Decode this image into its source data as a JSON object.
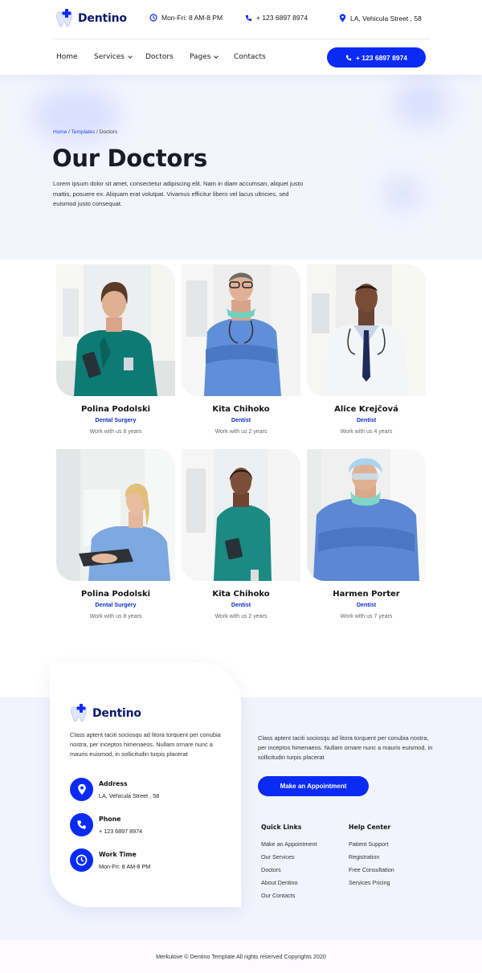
{
  "brand": {
    "name": "Dentino"
  },
  "topbar": {
    "hours": "Mon-Fri: 8 AM-8 PM",
    "phone": "+ 123 6897 8974",
    "address": "LA, Vehicula Street , 58"
  },
  "nav": {
    "items": [
      {
        "label": "Home",
        "dropdown": false
      },
      {
        "label": "Services",
        "dropdown": true
      },
      {
        "label": "Doctors",
        "dropdown": false
      },
      {
        "label": "Pages",
        "dropdown": true
      },
      {
        "label": "Contacts",
        "dropdown": false
      }
    ],
    "cta_label": "+ 123 6897 8974"
  },
  "hero": {
    "breadcrumb": {
      "home": "Home",
      "templates": "Templates",
      "current": "Doctors",
      "separator": "/"
    },
    "title": "Our Doctors",
    "text": "Lorem ipsum dolor sit amet, consectetur adipiscing elit. Nam in diam accumsan, aliquet justo mattis, posuere ex. Aliquam erat volutpat. Vivamus efficitur libero vel lacus ultricies, sed euismod justo consequat."
  },
  "doctors": [
    {
      "name": "Polina Podolski",
      "role": "Dental Surgery",
      "experience": "Work with us 8 years"
    },
    {
      "name": "Kita Chihoko",
      "role": "Dentist",
      "experience": "Work with us 2 years"
    },
    {
      "name": "Alice Krejčová",
      "role": "Dentist",
      "experience": "Work with us 4 years"
    },
    {
      "name": "Polina Podolski",
      "role": "Dental Surgery",
      "experience": "Work with us 8 years"
    },
    {
      "name": "Kita Chihoko",
      "role": "Dentist",
      "experience": "Work with us 2 years"
    },
    {
      "name": "Harmen Porter",
      "role": "Dentist",
      "experience": "Work with us 7 years"
    }
  ],
  "footer": {
    "brand": "Dentino",
    "about": "Class aptent taciti sociosqu ad litora torquent per conubia nostra, per inceptos himenaeos. Nullam ornare nunc a mauris euismod, in sollicitudin turpis placerat",
    "contacts": [
      {
        "title": "Address",
        "value": "LA, Vehicula Street , 58",
        "icon": "location-pin-icon"
      },
      {
        "title": "Phone",
        "value": "+ 123 6897 8974",
        "icon": "phone-icon"
      },
      {
        "title": "Work Time",
        "value": "Mon-Fri: 8 AM-8 PM",
        "icon": "clock-icon"
      }
    ],
    "right_text": "Class aptent taciti sociosqu ad litora torquent per conubia nostra, per inceptos himenaeos. Nullam ornare nunc a mauris euismod, in sollicitudin turpis placerat",
    "appointment_label": "Make an Appointment",
    "quick_links": {
      "title": "Quick Links",
      "items": [
        "Make an Appointment",
        "Our Services",
        "Doctors",
        "About Dentino",
        "Our Contacts"
      ]
    },
    "help_center": {
      "title": "Help Center",
      "items": [
        "Patient Support",
        "Registration",
        "Free Consultation",
        "Services Pricing"
      ]
    },
    "copyright": "Merkulove © Dentino Template All rights reserved Copyrights 2020"
  },
  "colors": {
    "accent": "#0b2bf5",
    "navy": "#0a1a6e",
    "hero_bg": "#f3f5fd",
    "footer_bg": "#f1f4fd"
  }
}
